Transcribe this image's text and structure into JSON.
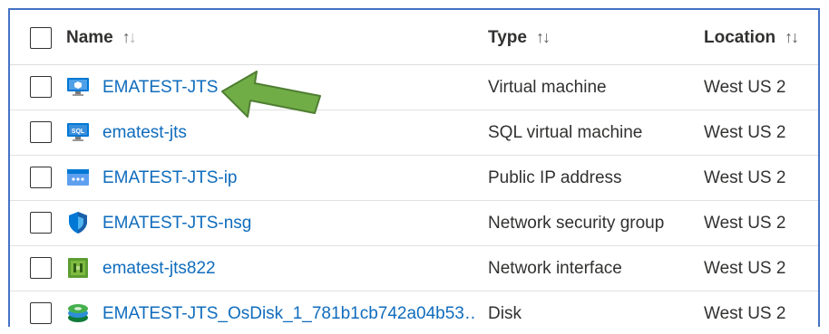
{
  "header": {
    "name_label": "Name",
    "type_label": "Type",
    "location_label": "Location",
    "sort_up": "↑",
    "sort_down": "↓"
  },
  "rows": [
    {
      "name": "EMATEST-JTS",
      "type": "Virtual machine",
      "location": "West US 2",
      "icon": "virtual-machine-icon"
    },
    {
      "name": "ematest-jts",
      "type": "SQL virtual machine",
      "location": "West US 2",
      "icon": "sql-virtual-machine-icon"
    },
    {
      "name": "EMATEST-JTS-ip",
      "type": "Public IP address",
      "location": "West US 2",
      "icon": "public-ip-icon"
    },
    {
      "name": "EMATEST-JTS-nsg",
      "type": "Network security group",
      "location": "West US 2",
      "icon": "network-security-group-icon"
    },
    {
      "name": "ematest-jts822",
      "type": "Network interface",
      "location": "West US 2",
      "icon": "network-interface-icon"
    },
    {
      "name": "EMATEST-JTS_OsDisk_1_781b1cb742a04b53…",
      "type": "Disk",
      "location": "West US 2",
      "icon": "disk-icon"
    }
  ],
  "icon_text": {
    "sql": "SQL"
  },
  "colors": {
    "link": "#0f6cbd",
    "border": "#4472c4",
    "arrow": "#70ad47"
  }
}
